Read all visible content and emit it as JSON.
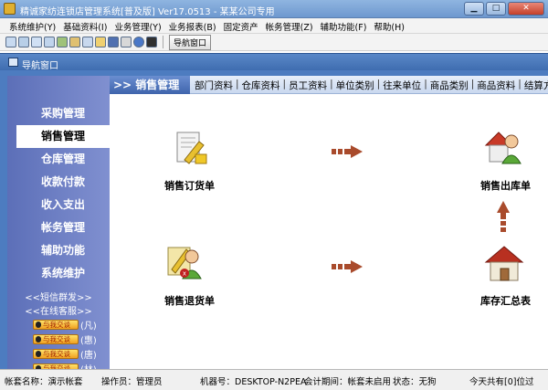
{
  "window": {
    "title": "精诚家纺连锁店管理系统[普及版] Ver17.0513 - 某某公司专用",
    "minimize_label": "▁",
    "maximize_label": "□",
    "close_label": "✕"
  },
  "menu": {
    "items": [
      "系统维护(Y)",
      "基础资料(I)",
      "业务管理(Y)",
      "业务报表(B)",
      "固定资产",
      "帐务管理(Z)",
      "辅助功能(F)",
      "帮助(H)"
    ]
  },
  "toolbar": {
    "nav_button_label": "导航窗口",
    "icons": [
      "window-icon",
      "form-icon",
      "list-icon",
      "copy-icon",
      "settings-icon",
      "users-icon",
      "print-preview-icon",
      "open-icon",
      "save-icon",
      "print-icon",
      "help-icon",
      "exit-icon"
    ]
  },
  "nav_window": {
    "title": "导航窗口"
  },
  "sidebar": {
    "items": [
      {
        "label": "采购管理",
        "active": false
      },
      {
        "label": "销售管理",
        "active": true
      },
      {
        "label": "仓库管理",
        "active": false
      },
      {
        "label": "收款付款",
        "active": false
      },
      {
        "label": "收入支出",
        "active": false
      },
      {
        "label": "帐务管理",
        "active": false
      },
      {
        "label": "辅助功能",
        "active": false
      },
      {
        "label": "系统维护",
        "active": false
      }
    ],
    "sms_link": "<<短信群发>>",
    "service_link": "<<在线客服>>",
    "qq_button_label": "与我交谈",
    "qq_contacts": [
      "(凡)",
      "(惠)",
      "(唐)",
      "(林)"
    ]
  },
  "content": {
    "section_title": ">> 销售管理",
    "tabs": [
      "部门资料",
      "仓库资料",
      "员工资料",
      "单位类别",
      "往来单位",
      "商品类别",
      "商品资料",
      "结算方"
    ],
    "flow": {
      "sales_order": "销售订货单",
      "sales_outbound": "销售出库单",
      "sales_return": "销售退货单",
      "inventory_summary": "库存汇总表"
    }
  },
  "statusbar": {
    "account": "帐套名称：演示帐套",
    "operator": "操作员：管理员",
    "machine": "机器号：DESKTOP-N2PEA",
    "period": "会计期间：帐套未启用",
    "state": "状态：无狗",
    "reminder": "今天共有[0]位过"
  },
  "colors": {
    "titlebar": "#7aa3d8",
    "sidebar": "#6b7cc4",
    "frame": "#4d7cc0",
    "arrow": "#a94b2c"
  }
}
